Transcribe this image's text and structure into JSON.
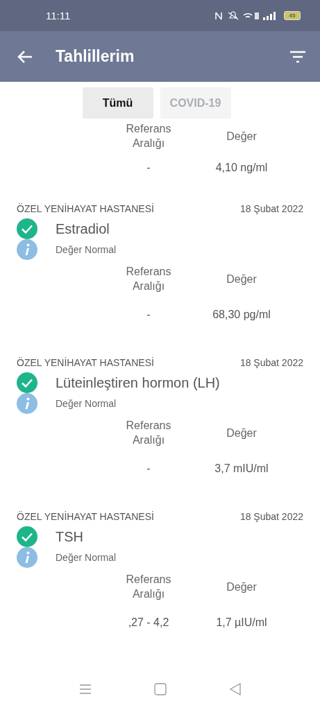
{
  "status_bar": {
    "time": "11:11",
    "battery": "45"
  },
  "app_bar": {
    "title": "Tahlillerim"
  },
  "tabs": [
    {
      "label": "Tümü",
      "selected": true
    },
    {
      "label": "COVID-19",
      "selected": false
    }
  ],
  "results": [
    {
      "ref_header": "Referans Aralığı",
      "value_header": "Değer",
      "ref": "-",
      "value": "4,10 ng/ml"
    },
    {
      "hospital": "ÖZEL YENİHAYAT HASTANESİ",
      "date": "18 Şubat 2022",
      "name": "Estradiol",
      "normal": true,
      "status": "Değer Normal",
      "ref_header": "Referans Aralığı",
      "value_header": "Değer",
      "ref": "-",
      "value": "68,30 pg/ml"
    },
    {
      "hospital": "ÖZEL YENİHAYAT HASTANESİ",
      "date": "18 Şubat 2022",
      "name": "Lüteinleştiren hormon (LH)",
      "normal": true,
      "status": "Değer Normal",
      "ref_header": "Referans Aralığı",
      "value_header": "Değer",
      "ref": "-",
      "value": "3,7 mIU/ml"
    },
    {
      "hospital": "ÖZEL YENİHAYAT HASTANESİ",
      "date": "18 Şubat 2022",
      "name": "TSH",
      "normal": true,
      "status": "Değer Normal",
      "ref_header": "Referans Aralığı",
      "value_header": "Değer",
      "ref": ",27 - 4,2",
      "value": "1,7 µIU/ml"
    }
  ]
}
